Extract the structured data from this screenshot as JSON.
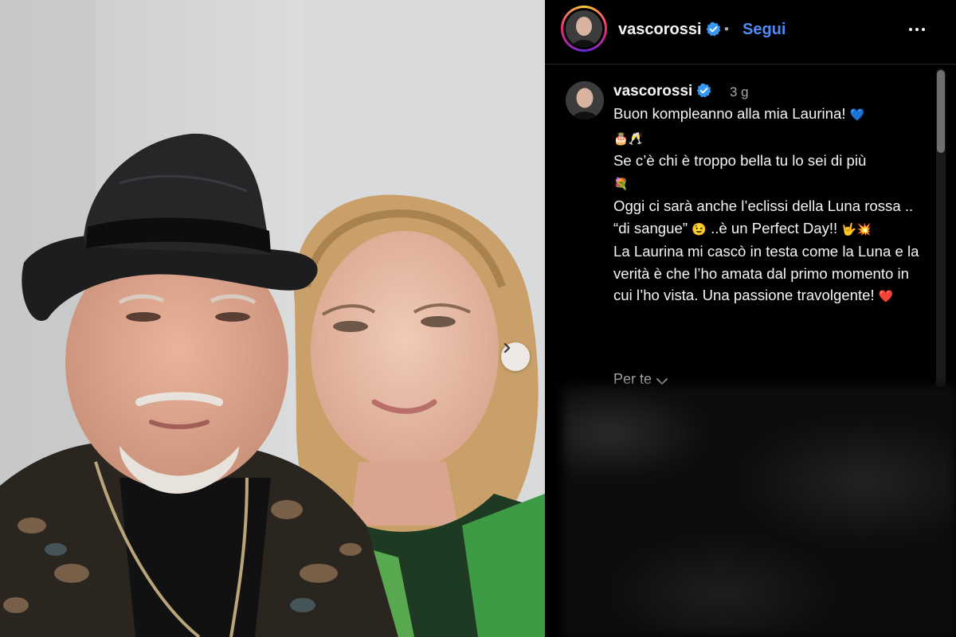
{
  "post": {
    "username": "vascorossi",
    "follow_label": "Segui",
    "separator": "•",
    "time": "3 g",
    "caption": [
      "Buon kompleanno alla mia Laurina!",
      "Se c’è chi è troppo bella tu lo sei di più",
      "Oggi ci sarà anche l’eclissi della Luna rossa .. “di sangue”",
      "..è un Perfect Day!!",
      "La Laurina mi cascò in testa come la Luna e la verità è che l’ho amata dal primo momento in cui l’ho vista. Una passione travolgente!"
    ],
    "emoji": {
      "blue_heart": "💙",
      "cake_toast": "🎂🥂",
      "bouquet": "💐",
      "wink": "😉",
      "rock": "🤟💥",
      "red_heart": "❤️"
    },
    "per_te_label": "Per te"
  },
  "icons": {
    "verified": "verified-badge-icon",
    "more": "more-options-icon",
    "next": "chevron-right-icon",
    "per_te": "chevron-down-icon"
  },
  "colors": {
    "accent": "#4f8cf7",
    "verified": "#3897f0",
    "muted_text": "#a8a8a8"
  }
}
